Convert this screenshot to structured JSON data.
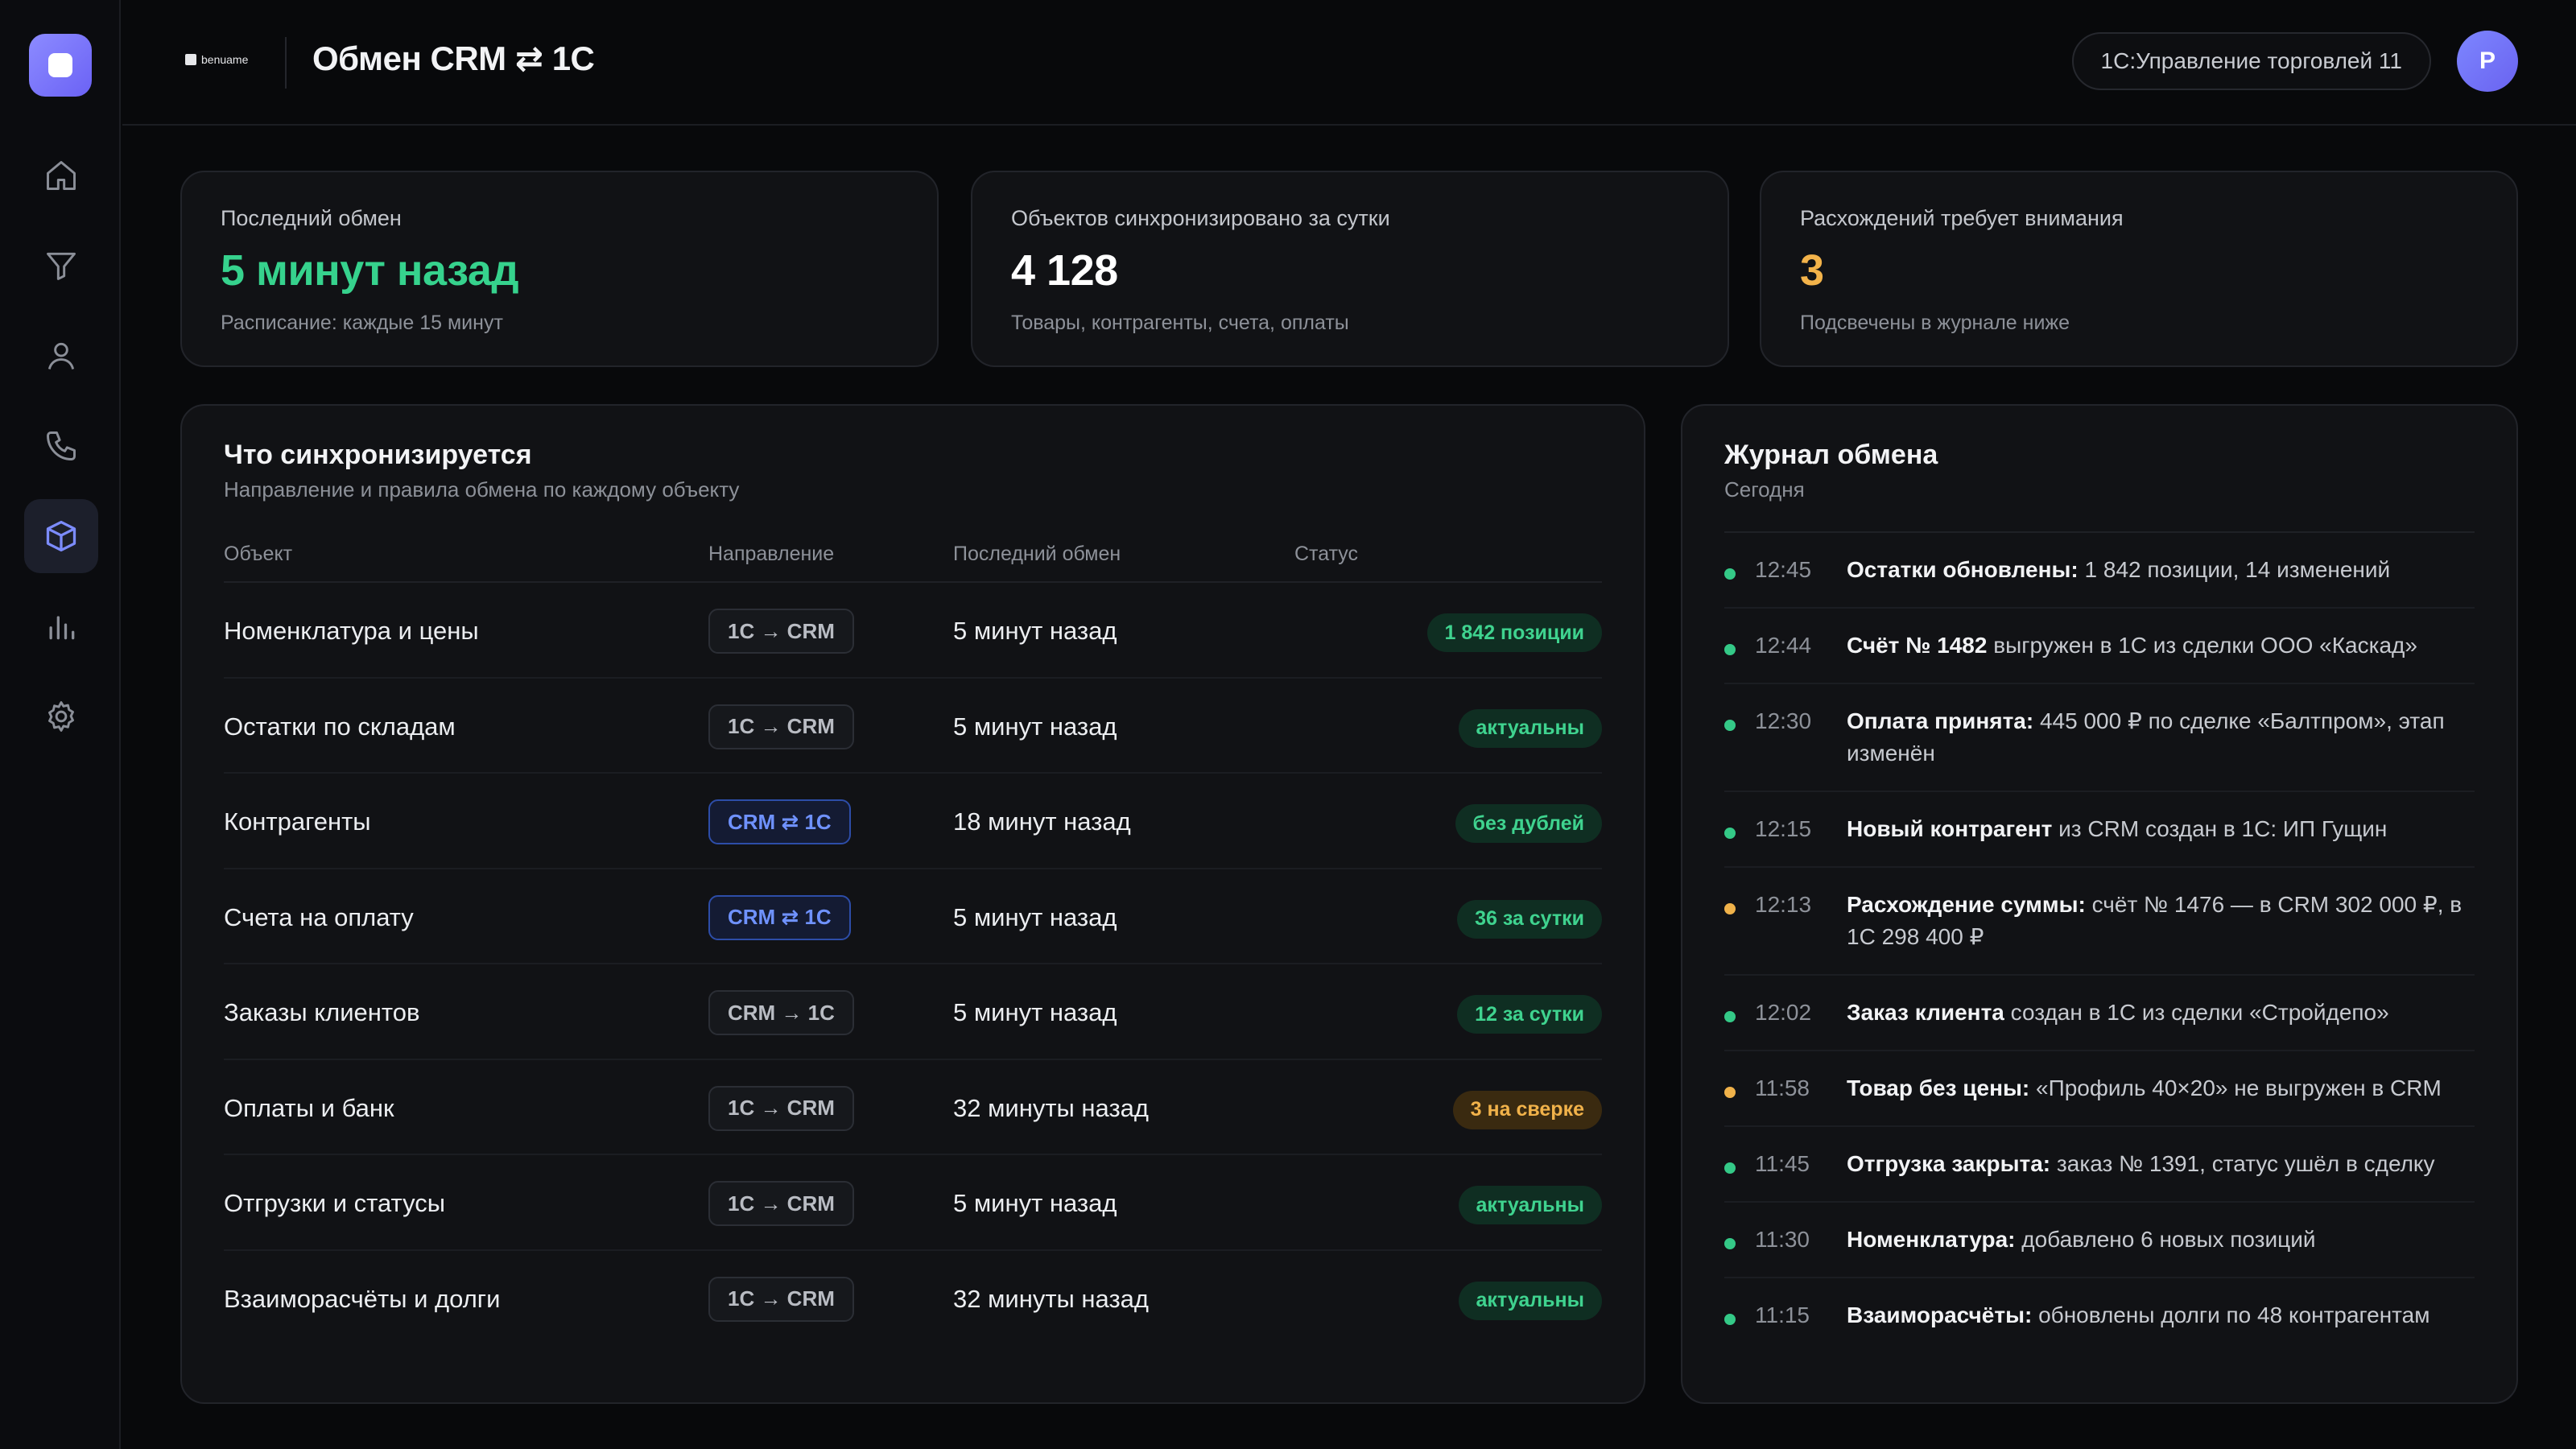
{
  "header": {
    "brand": "benuame",
    "title": "Обмен CRM ⇄ 1С",
    "system": "1С:Управление торговлей 11",
    "avatar_initial": "Р"
  },
  "sidebar": {
    "items": [
      {
        "icon": "home-icon"
      },
      {
        "icon": "filter-icon"
      },
      {
        "icon": "user-icon"
      },
      {
        "icon": "phone-icon"
      },
      {
        "icon": "cube-icon",
        "active": true
      },
      {
        "icon": "bar-chart-icon"
      },
      {
        "icon": "gear-icon"
      }
    ]
  },
  "kpis": [
    {
      "label": "Последний обмен",
      "value": "5 минут назад",
      "sub": "Расписание: каждые 15 минут",
      "color": "#36d28d"
    },
    {
      "label": "Объектов синхронизировано за сутки",
      "value": "4 128",
      "sub": "Товары, контрагенты, счета, оплаты",
      "color": "#ffffff"
    },
    {
      "label": "Расхождений требует внимания",
      "value": "3",
      "sub": "Подсвечены в журнале ниже",
      "color": "#f3b34a"
    }
  ],
  "sync": {
    "title": "Что синхронизируется",
    "subtitle": "Направление и правила обмена по каждому объекту",
    "columns": {
      "object": "Объект",
      "direction": "Направление",
      "last": "Последний обмен",
      "status": "Статус"
    },
    "rows": [
      {
        "object": "Номенклатура и цены",
        "direction": "1С → CRM",
        "last": "5 минут назад",
        "status": "1 842 позиции"
      },
      {
        "object": "Остатки по складам",
        "direction": "1С → CRM",
        "last": "5 минут назад",
        "status": "актуальны"
      },
      {
        "object": "Контрагенты",
        "direction": "CRM ⇄ 1С",
        "last": "18 минут назад",
        "status": "без дублей"
      },
      {
        "object": "Счета на оплату",
        "direction": "CRM ⇄ 1С",
        "last": "5 минут назад",
        "status": "36 за сутки"
      },
      {
        "object": "Заказы клиентов",
        "direction": "CRM → 1С",
        "last": "5 минут назад",
        "status": "12 за сутки"
      },
      {
        "object": "Оплаты и банк",
        "direction": "1С → CRM",
        "last": "32 минуты назад",
        "status": "3 на сверке"
      },
      {
        "object": "Отгрузки и статусы",
        "direction": "1С → CRM",
        "last": "5 минут назад",
        "status": "актуальны"
      },
      {
        "object": "Взаиморасчёты и долги",
        "direction": "1С → CRM",
        "last": "32 минуты назад",
        "status": "актуальны"
      }
    ]
  },
  "journal": {
    "title": "Журнал обмена",
    "subtitle": "Сегодня",
    "entries": [
      {
        "time": "12:45",
        "bold": "Остатки обновлены:",
        "text": " 1 842 позиции, 14 изменений"
      },
      {
        "time": "12:44",
        "bold": "Счёт № 1482",
        "text": " выгружен в 1С из сделки ООО «Каскад»"
      },
      {
        "time": "12:30",
        "bold": "Оплата принята:",
        "text": " 445 000 ₽ по сделке «Балтпром», этап изменён"
      },
      {
        "time": "12:15",
        "bold": "Новый контрагент",
        "text": " из CRM создан в 1С: ИП Гущин"
      },
      {
        "time": "12:13",
        "bold": "Расхождение суммы:",
        "text": " счёт № 1476 — в CRM 302 000 ₽, в 1С 298 400 ₽"
      },
      {
        "time": "12:02",
        "bold": "Заказ клиента",
        "text": " создан в 1С из сделки «Стройдепо»"
      },
      {
        "time": "11:58",
        "bold": "Товар без цены:",
        "text": " «Профиль 40×20» не выгружен в CRM"
      },
      {
        "time": "11:45",
        "bold": "Отгрузка закрыта:",
        "text": " заказ № 1391, статус ушёл в сделку"
      },
      {
        "time": "11:30",
        "bold": "Номенклатура:",
        "text": " добавлено 6 новых позиций"
      },
      {
        "time": "11:15",
        "bold": "Взаиморасчёты:",
        "text": " обновлены долги по 48 контрагентам"
      }
    ]
  }
}
